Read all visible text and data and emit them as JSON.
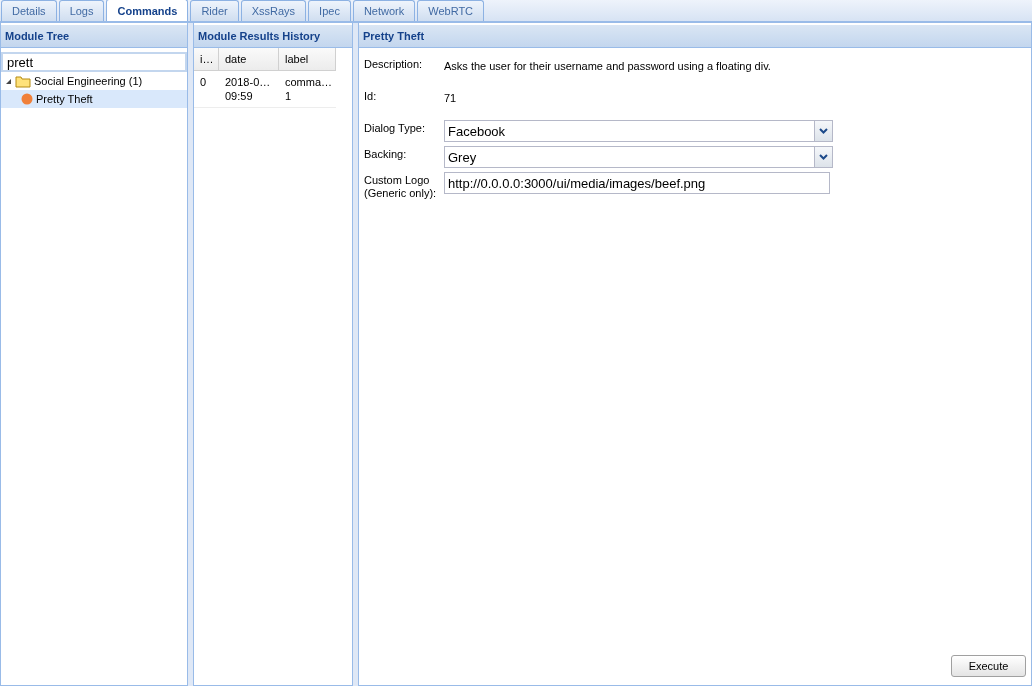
{
  "tabs": [
    {
      "label": "Details",
      "selected": false
    },
    {
      "label": "Logs",
      "selected": false
    },
    {
      "label": "Commands",
      "selected": true
    },
    {
      "label": "Rider",
      "selected": false
    },
    {
      "label": "XssRays",
      "selected": false
    },
    {
      "label": "Ipec",
      "selected": false
    },
    {
      "label": "Network",
      "selected": false
    },
    {
      "label": "WebRTC",
      "selected": false
    }
  ],
  "module_tree": {
    "title": "Module Tree",
    "search": {
      "value": "prett"
    },
    "items": [
      {
        "label": "Social Engineering (1)",
        "expanded": true,
        "selected": false,
        "children": [
          {
            "label": "Pretty Theft",
            "selected": true
          }
        ]
      }
    ]
  },
  "results_history": {
    "title": "Module Results History",
    "columns": [
      "i…",
      "date",
      "label"
    ],
    "rows": [
      [
        "0",
        "2018-0…\n09:59",
        "comma…\n1"
      ]
    ]
  },
  "module": {
    "title": "Pretty Theft",
    "fields": [
      {
        "kind": "info",
        "label": "Description:",
        "value": "Asks the user for their username and password using a floating div."
      },
      {
        "kind": "info",
        "label": "Id:",
        "value": "71"
      },
      {
        "kind": "select",
        "label": "Dialog Type:",
        "value": "Facebook"
      },
      {
        "kind": "select",
        "label": "Backing:",
        "value": "Grey"
      },
      {
        "kind": "text",
        "label": "Custom Logo\n(Generic only):",
        "value": "http://0.0.0.0:3000/ui/media/images/beef.png"
      }
    ],
    "button": "Execute"
  }
}
